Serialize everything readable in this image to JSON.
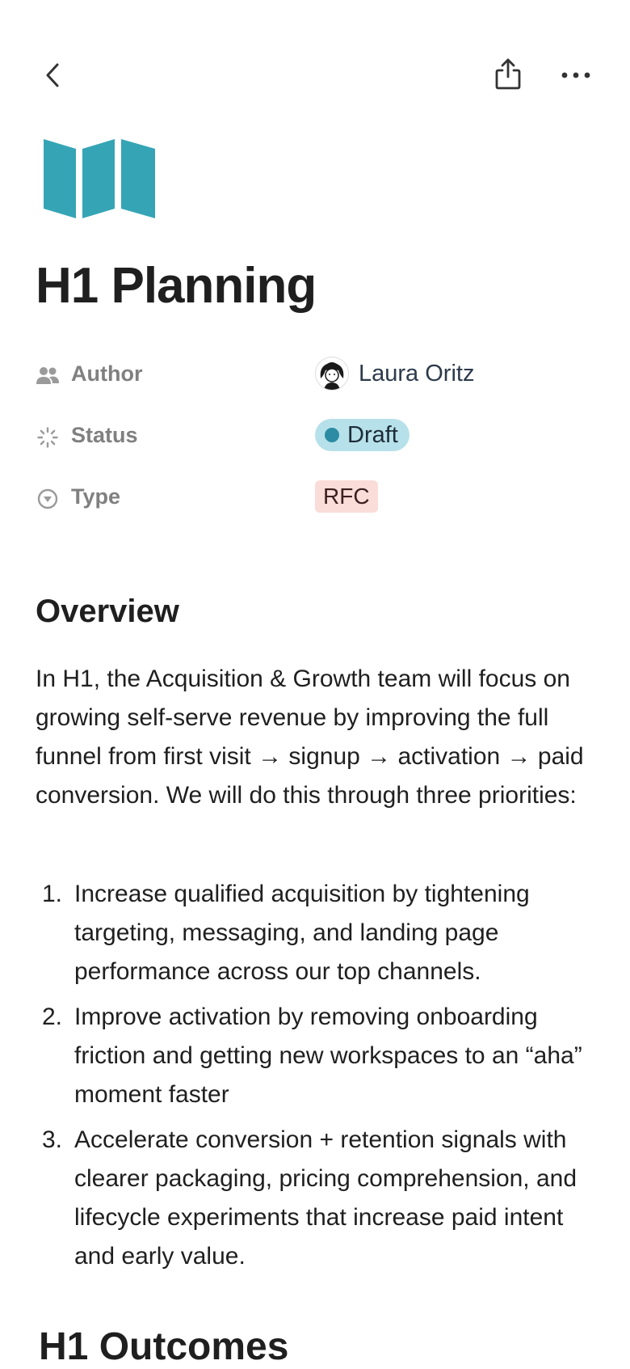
{
  "header": {
    "back_icon": "chevron-left-icon",
    "share_icon": "share-icon",
    "more_icon": "more-horizontal-icon"
  },
  "page": {
    "icon": "map-icon",
    "icon_color": "#35a5b5",
    "title": "H1 Planning"
  },
  "properties": [
    {
      "icon": "people-icon",
      "label": "Author",
      "value": "Laura Oritz"
    },
    {
      "icon": "status-icon",
      "label": "Status",
      "value": "Draft",
      "pill_color": "#b7e1ea",
      "dot_color": "#2b8ca3"
    },
    {
      "icon": "select-icon",
      "label": "Type",
      "value": "RFC",
      "chip_color": "#fadcd9"
    }
  ],
  "overview": {
    "heading": "Overview",
    "paragraph": "In H1, the Acquisition & Growth team will focus on growing self-serve revenue by improving the full funnel from first visit → signup → activation → paid conversion. We will do this through three priorities:",
    "list": [
      {
        "num": "1.",
        "text": "Increase qualified acquisition by tightening targeting, messaging, and landing page performance across our top channels."
      },
      {
        "num": "2.",
        "text": "Improve activation by removing onboarding friction and getting new workspaces to an “aha” moment faster"
      },
      {
        "num": "3.",
        "text": "Accelerate conversion + retention signals with clearer packaging, pricing comprehension, and lifecycle experiments that increase paid intent and early value."
      }
    ]
  },
  "next_section": {
    "heading": "H1 Outcomes"
  }
}
